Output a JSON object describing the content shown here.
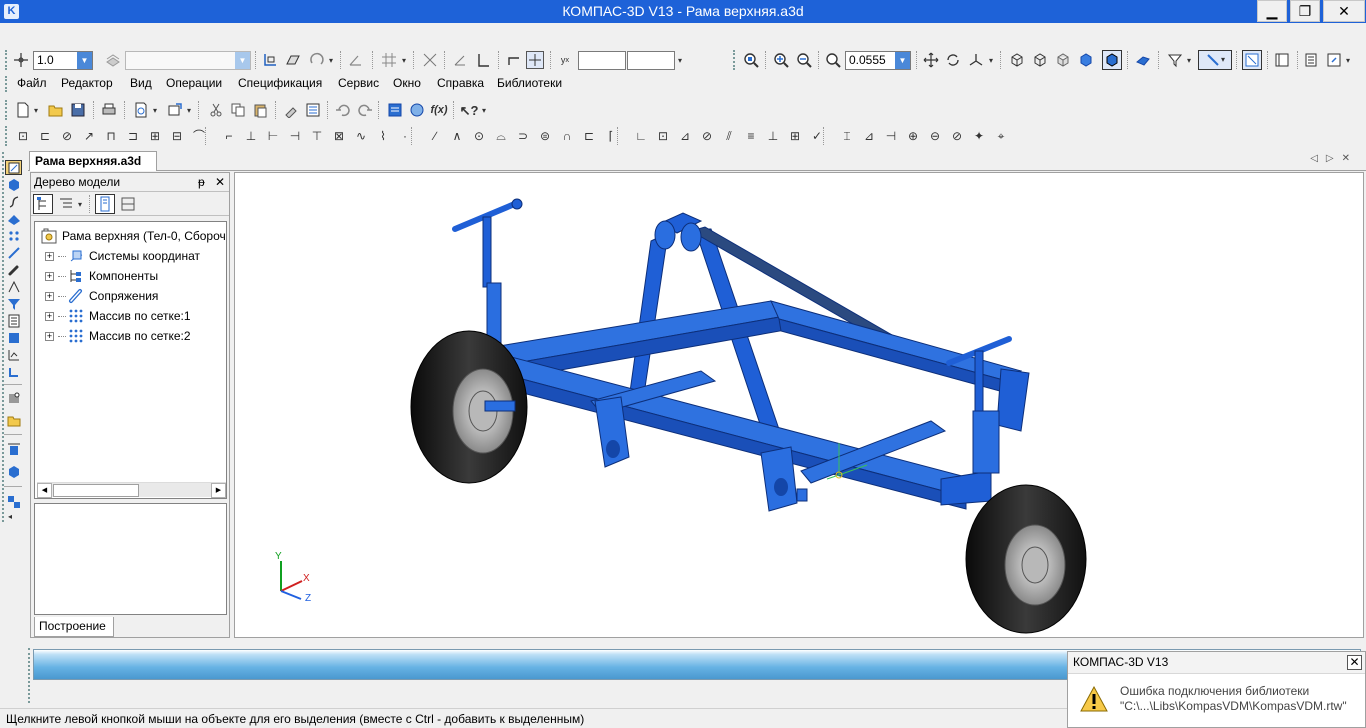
{
  "window": {
    "title": "КОМПАС-3D V13 - Рама верхняя.a3d",
    "minimize": "▁",
    "restore": "❐",
    "close": "✕"
  },
  "toolbar_top": {
    "line_width": "1.0",
    "style_value": "",
    "scale_value": "0.0555"
  },
  "menu": {
    "items": [
      "Файл",
      "Редактор",
      "Вид",
      "Операции",
      "Спецификация",
      "Сервис",
      "Окно",
      "Справка",
      "Библиотеки"
    ]
  },
  "document": {
    "tab_label": "Рама верхняя.a3d"
  },
  "tree": {
    "header": "Дерево модели",
    "pin": "ᵽ",
    "close": "✕",
    "nodes": [
      {
        "label": "Рама верхняя (Тел-0, Сбороч",
        "icon": "assembly-icon"
      },
      {
        "label": "Системы координат",
        "icon": "coordinate-system-icon"
      },
      {
        "label": "Компоненты",
        "icon": "components-icon"
      },
      {
        "label": "Сопряжения",
        "icon": "mates-icon"
      },
      {
        "label": "Массив по сетке:1",
        "icon": "grid-array-icon"
      },
      {
        "label": "Массив по сетке:2",
        "icon": "grid-array-icon"
      }
    ],
    "expander": "+",
    "bottom_tab": "Построение"
  },
  "axes": {
    "x": "X",
    "y": "Y",
    "z": "Z"
  },
  "statusbar": {
    "text": "Щелкните левой кнопкой мыши на объекте для его выделения (вместе с Ctrl - добавить к выделенным)"
  },
  "notification": {
    "title": "КОМПАС-3D V13",
    "close": "✕",
    "line1": "Ошибка подключения библиотеки",
    "line2": "\"C:\\...\\Libs\\KompasVDM\\KompasVDM.rtw\""
  },
  "colors": {
    "titlebar": "#1e62d8",
    "frame": "#1f5fd6",
    "frame_dark": "#1446a8",
    "tire": "#1c1c1c"
  }
}
